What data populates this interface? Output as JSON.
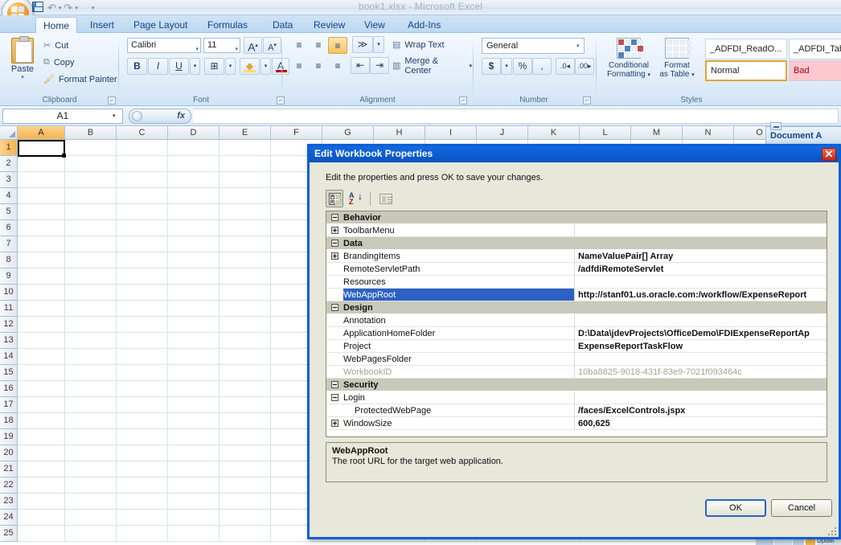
{
  "window": {
    "title": "book1.xlsx - Microsoft Excel"
  },
  "quick_access": {
    "save_tip": "Save",
    "undo_tip": "Undo",
    "redo_tip": "Redo",
    "customize_tip": "Customize Quick Access Toolbar"
  },
  "ribbon": {
    "tabs": [
      {
        "label": "Home",
        "active": true
      },
      {
        "label": "Insert",
        "active": false
      },
      {
        "label": "Page Layout",
        "active": false
      },
      {
        "label": "Formulas",
        "active": false
      },
      {
        "label": "Data",
        "active": false
      },
      {
        "label": "Review",
        "active": false
      },
      {
        "label": "View",
        "active": false
      },
      {
        "label": "Add-Ins",
        "active": false
      }
    ],
    "clipboard": {
      "group_label": "Clipboard",
      "paste_label": "Paste",
      "cut_label": "Cut",
      "copy_label": "Copy",
      "format_painter_label": "Format Painter"
    },
    "font": {
      "group_label": "Font",
      "font_name": "Calibri",
      "font_size": "11",
      "grow_font": "A",
      "shrink_font": "A",
      "bold": "B",
      "italic": "I",
      "underline": "U"
    },
    "alignment": {
      "group_label": "Alignment",
      "wrap_text_label": "Wrap Text",
      "merge_center_label": "Merge & Center"
    },
    "number": {
      "group_label": "Number",
      "format": "General",
      "currency": "$",
      "percent": "%",
      "comma": ","
    },
    "styles": {
      "group_label": "Styles",
      "conditional_formatting_line1": "Conditional",
      "conditional_formatting_line2": "Formatting",
      "format_as_table_line1": "Format",
      "format_as_table_line2": "as Table",
      "gallery": [
        {
          "label": "_ADFDI_ReadO...",
          "state": "normal"
        },
        {
          "label": "_ADFDI_Tab",
          "state": "normal"
        },
        {
          "label": "Normal",
          "state": "selected"
        },
        {
          "label": "Bad",
          "state": "bad"
        }
      ]
    }
  },
  "formula_bar": {
    "name_box": "A1",
    "fx_label": "fx",
    "formula_value": ""
  },
  "grid": {
    "columns": [
      "A",
      "B",
      "C",
      "D",
      "E",
      "F",
      "G",
      "H",
      "I",
      "J",
      "K",
      "L",
      "M",
      "N",
      "O"
    ],
    "selected_column": "A",
    "rows": [
      "1",
      "2",
      "3",
      "4",
      "5",
      "6",
      "7",
      "8",
      "9",
      "10",
      "11",
      "12",
      "13",
      "14",
      "15",
      "16",
      "17",
      "18",
      "19",
      "20",
      "21",
      "22",
      "23",
      "24",
      "25"
    ],
    "selected_row": "1",
    "active_cell": "A1"
  },
  "task_pane": {
    "title": "Document A"
  },
  "dialog": {
    "title": "Edit Workbook Properties",
    "close_label": "✕",
    "instruction": "Edit the properties and press OK to save your changes.",
    "toolbar": [
      {
        "name": "categorized",
        "state": "pressed"
      },
      {
        "name": "alphabetical",
        "state": "normal"
      },
      {
        "name": "property-pages",
        "state": "disabled"
      }
    ],
    "alpha_icon": {
      "top": "A",
      "bottom": "Z",
      "arrow": "↓"
    },
    "properties": [
      {
        "kind": "category",
        "name": "Behavior",
        "value": "",
        "expander": "minus"
      },
      {
        "kind": "property",
        "name": "ToolbarMenu",
        "value": "",
        "expander": "plus",
        "indent": false,
        "selected": false,
        "readonly": false
      },
      {
        "kind": "category",
        "name": "Data",
        "value": "",
        "expander": "minus"
      },
      {
        "kind": "property",
        "name": "BrandingItems",
        "value": "NameValuePair[] Array",
        "expander": "plus",
        "indent": false,
        "selected": false,
        "readonly": false
      },
      {
        "kind": "property",
        "name": "RemoteServletPath",
        "value": "/adfdiRemoteServlet",
        "expander": "none",
        "indent": false,
        "selected": false,
        "readonly": false
      },
      {
        "kind": "property",
        "name": "Resources",
        "value": "",
        "expander": "none",
        "indent": false,
        "selected": false,
        "readonly": false
      },
      {
        "kind": "property",
        "name": "WebAppRoot",
        "value": "http://stanf01.us.oracle.com:/workflow/ExpenseReport",
        "expander": "none",
        "indent": false,
        "selected": true,
        "readonly": false
      },
      {
        "kind": "category",
        "name": "Design",
        "value": "",
        "expander": "minus"
      },
      {
        "kind": "property",
        "name": "Annotation",
        "value": "",
        "expander": "none",
        "indent": false,
        "selected": false,
        "readonly": false
      },
      {
        "kind": "property",
        "name": "ApplicationHomeFolder",
        "value": "D:\\Data\\jdevProjects\\OfficeDemo\\FDIExpenseReportAp",
        "expander": "none",
        "indent": false,
        "selected": false,
        "readonly": false
      },
      {
        "kind": "property",
        "name": "Project",
        "value": "ExpenseReportTaskFlow",
        "expander": "none",
        "indent": false,
        "selected": false,
        "readonly": false
      },
      {
        "kind": "property",
        "name": "WebPagesFolder",
        "value": "",
        "expander": "none",
        "indent": false,
        "selected": false,
        "readonly": false
      },
      {
        "kind": "property",
        "name": "WorkbookID",
        "value": "10ba8825-9018-431f-83e9-7021f093464c",
        "expander": "none",
        "indent": false,
        "selected": false,
        "readonly": true
      },
      {
        "kind": "category",
        "name": "Security",
        "value": "",
        "expander": "minus"
      },
      {
        "kind": "property",
        "name": "Login",
        "value": "",
        "expander": "minus",
        "indent": false,
        "selected": false,
        "readonly": false
      },
      {
        "kind": "property",
        "name": "ProtectedWebPage",
        "value": "/faces/ExcelControls.jspx",
        "expander": "none",
        "indent": true,
        "selected": false,
        "readonly": false
      },
      {
        "kind": "property",
        "name": "WindowSize",
        "value": "600,625",
        "expander": "plus",
        "indent": false,
        "selected": false,
        "readonly": false
      }
    ],
    "description": {
      "title": "WebAppRoot",
      "body": "The root URL for the target web application."
    },
    "ok_label": "OK",
    "cancel_label": "Cancel"
  },
  "colors": {
    "dialog_border": "#0a5fd4",
    "dialog_face": "#e7e8da",
    "selection_blue": "#2c62c4",
    "category_gray": "#c8c9bb",
    "readonly_gray": "#a3a495",
    "close_red": "#c62817",
    "excel_accent": "#15428b"
  }
}
